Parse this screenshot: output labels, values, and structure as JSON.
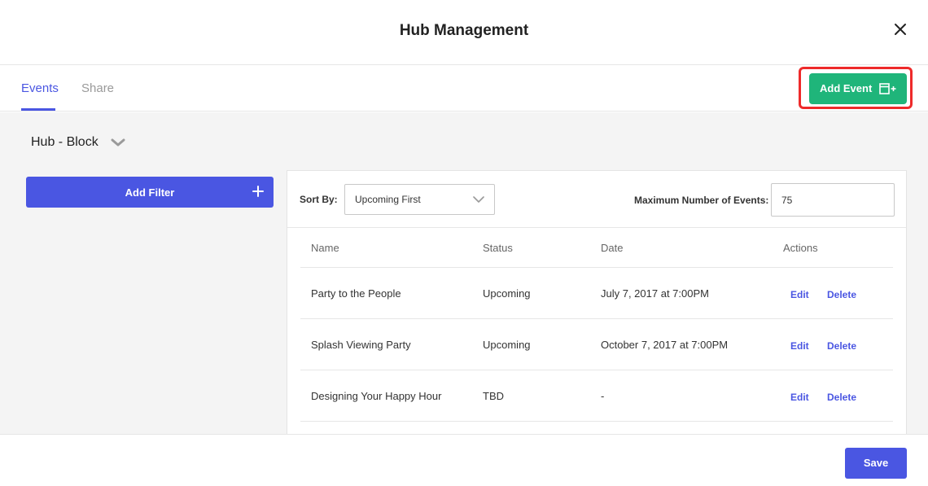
{
  "header": {
    "title": "Hub Management",
    "close_icon": "close-icon"
  },
  "tabs": [
    {
      "label": "Events",
      "active": true
    },
    {
      "label": "Share",
      "active": false
    }
  ],
  "add_event": {
    "label": "Add Event",
    "icon": "calendar-add-icon",
    "color": "#1fb57a",
    "highlight_color": "#ee2a2a"
  },
  "hub": {
    "selected": "Hub - Block",
    "icon": "chevron-down-icon"
  },
  "filter": {
    "label": "Add Filter",
    "icon": "plus-icon"
  },
  "sort": {
    "label": "Sort By:",
    "value": "Upcoming First"
  },
  "max_events": {
    "label": "Maximum Number of Events:",
    "value": "75"
  },
  "table": {
    "headers": [
      "Name",
      "Status",
      "Date",
      "Actions"
    ],
    "rows": [
      {
        "name": "Party to the People",
        "status": "Upcoming",
        "date": "July 7, 2017 at 7:00PM",
        "edit": "Edit",
        "delete": "Delete"
      },
      {
        "name": "Splash Viewing Party",
        "status": "Upcoming",
        "date": "October 7, 2017 at 7:00PM",
        "edit": "Edit",
        "delete": "Delete"
      },
      {
        "name": "Designing Your Happy Hour",
        "status": "TBD",
        "date": "-",
        "edit": "Edit",
        "delete": "Delete"
      }
    ]
  },
  "footer": {
    "save_label": "Save"
  },
  "colors": {
    "accent": "#4a56e2",
    "success": "#1fb57a",
    "background": "#f4f4f4"
  }
}
